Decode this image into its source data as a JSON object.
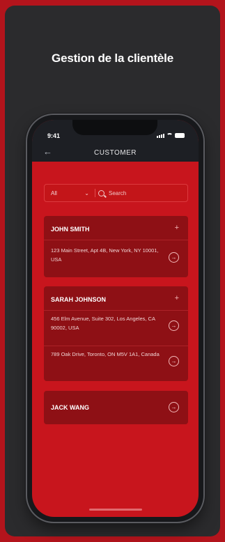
{
  "page": {
    "headline": "Gestion de la clientèle",
    "accent_red": "#b3141c",
    "card_dark": "#2b2b2d"
  },
  "phone": {
    "status_time": "9:41",
    "screen_title": "CUSTOMER",
    "back_icon": "arrow-left-icon",
    "filter_value": "All",
    "search_placeholder": "Search",
    "customers": [
      {
        "name": "JOHN SMITH",
        "addresses": [
          "123 Main Street, Apt 4B, New York, NY 10001, USA"
        ]
      },
      {
        "name": "SARAH JOHNSON",
        "addresses": [
          "456 Elm Avenue, Suite 302, Los Angeles, CA 90002, USA",
          "789 Oak Drive, Toronto, ON M5V 1A1, Canada"
        ]
      },
      {
        "name": "JACK WANG",
        "addresses": []
      }
    ]
  }
}
